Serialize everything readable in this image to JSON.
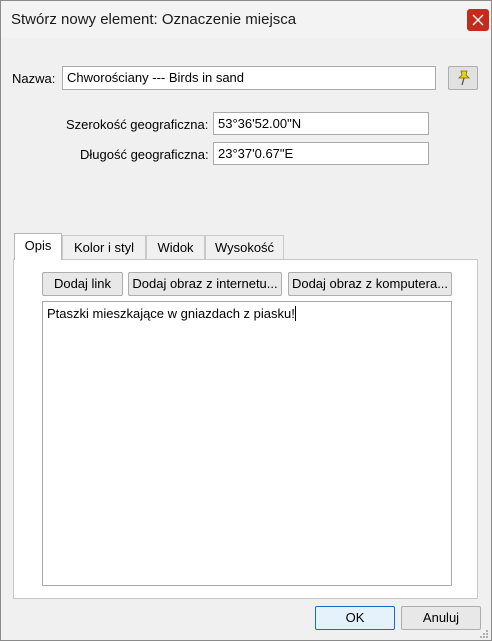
{
  "window": {
    "title": "Stwórz nowy element: Oznaczenie miejsca",
    "close_icon": "close-icon"
  },
  "form": {
    "name_label": "Nazwa:",
    "name_value": "Chworościany --- Birds in sand",
    "pin_icon": "pushpin-icon",
    "latitude_label": "Szerokość geograficzna:",
    "latitude_value": "53°36'52.00\"N",
    "longitude_label": "Długość geograficzna:",
    "longitude_value": "23°37'0.67\"E"
  },
  "tabs": [
    {
      "label": "Opis",
      "active": true
    },
    {
      "label": "Kolor i styl",
      "active": false
    },
    {
      "label": "Widok",
      "active": false
    },
    {
      "label": "Wysokość",
      "active": false
    }
  ],
  "description": {
    "add_link_label": "Dodaj link",
    "add_web_image_label": "Dodaj obraz z internetu...",
    "add_local_image_label": "Dodaj obraz z komputera...",
    "text": "Ptaszki mieszkające w gniazdach z piasku!"
  },
  "footer": {
    "ok_label": "OK",
    "cancel_label": "Anuluj"
  },
  "colors": {
    "close_button": "#c42b1c",
    "pin": "#e8d21a",
    "ok_border": "#1d68c4"
  }
}
